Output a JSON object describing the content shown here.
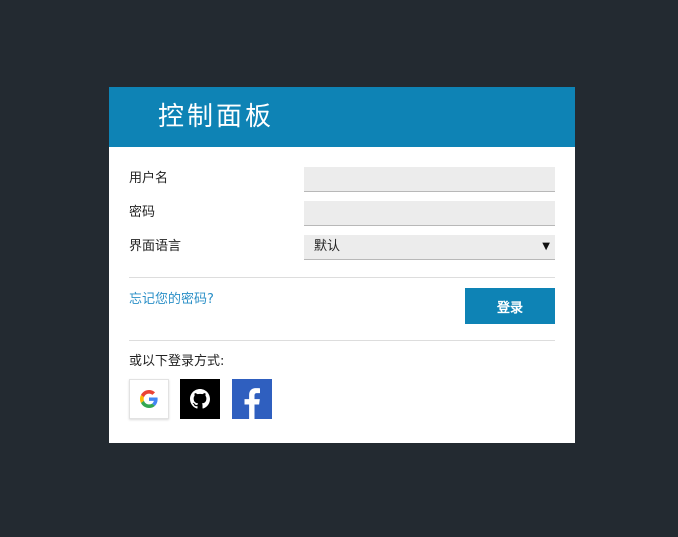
{
  "header": {
    "title": "控制面板"
  },
  "form": {
    "username_label": "用户名",
    "username_value": "",
    "password_label": "密码",
    "password_value": "",
    "language_label": "界面语言",
    "language_value": "默认"
  },
  "forgot_password": "忘记您的密码?",
  "login_button": "登录",
  "alt_login_text": "或以下登录方式:",
  "social": [
    {
      "icon": "google-icon"
    },
    {
      "icon": "github-icon"
    },
    {
      "icon": "facebook-icon"
    }
  ],
  "colors": {
    "page_background": "#232a31",
    "accent": "#0e83b5",
    "link": "#2a8fc7"
  }
}
